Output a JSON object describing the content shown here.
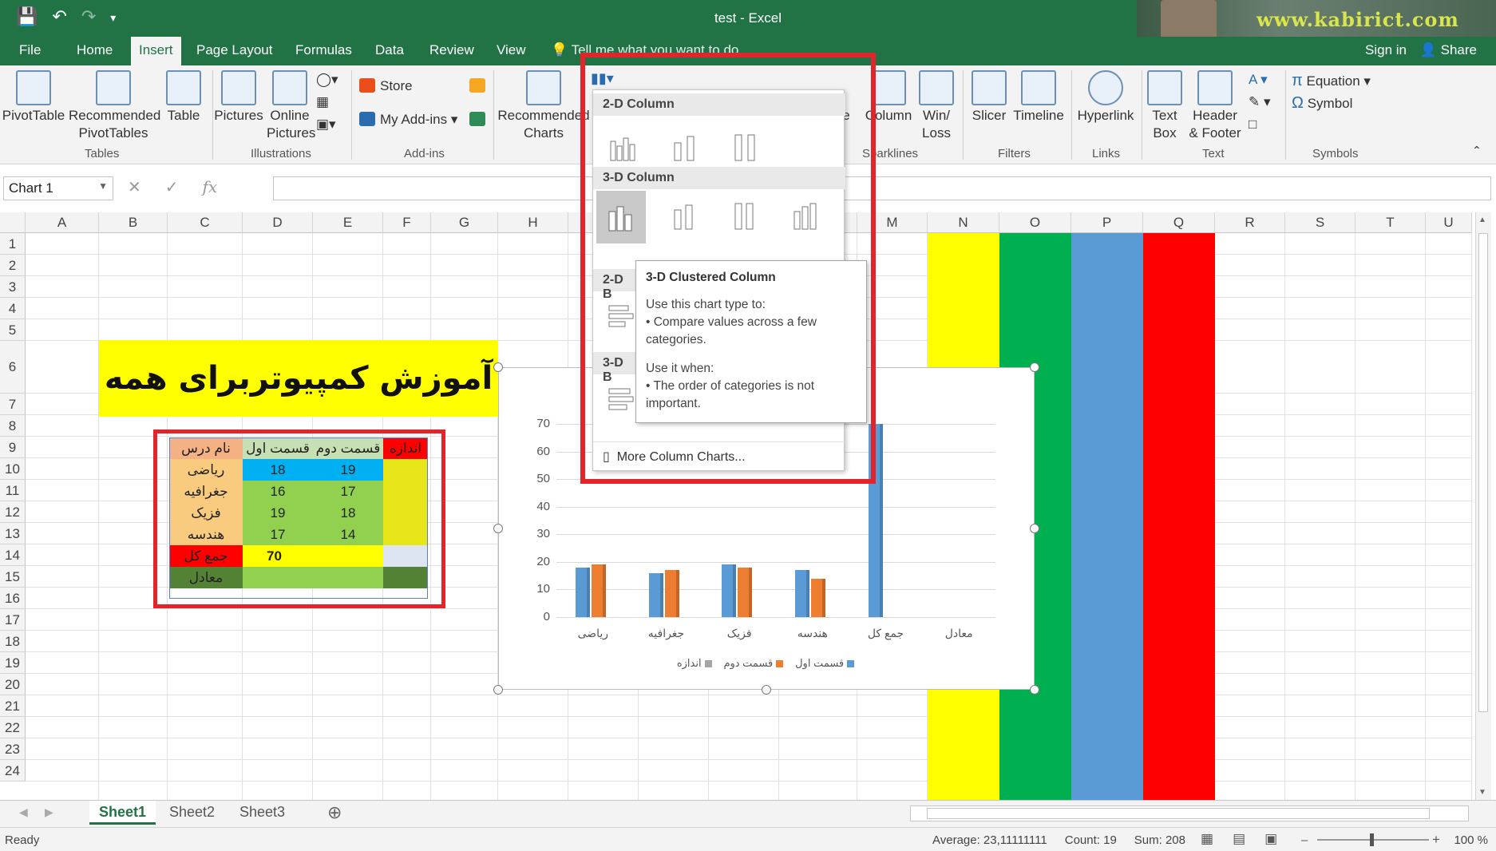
{
  "window": {
    "title": "test - Excel",
    "watermark": "www.kabirict.com"
  },
  "tabs": [
    "File",
    "Home",
    "Insert",
    "Page Layout",
    "Formulas",
    "Data",
    "Review",
    "View"
  ],
  "tell_me": "Tell me what you want to do",
  "account": {
    "sign_in": "Sign in",
    "share": "Share"
  },
  "ribbon": {
    "tables": {
      "label": "Tables",
      "pivot": "PivotTable",
      "rec_pivot": "Recommended PivotTables",
      "table": "Table"
    },
    "illustrations": {
      "label": "Illustrations",
      "pictures": "Pictures",
      "online_pictures": "Online Pictures"
    },
    "addins": {
      "label": "Add-ins",
      "store": "Store",
      "my_addins": "My Add-ins"
    },
    "charts": {
      "recommended": "Recommended Charts"
    },
    "sparklines": {
      "label": "Sparklines",
      "line_partial": "e",
      "column": "Column",
      "winloss": "Win/ Loss"
    },
    "filters": {
      "label": "Filters",
      "slicer": "Slicer",
      "timeline": "Timeline"
    },
    "links": {
      "label": "Links",
      "hyperlink": "Hyperlink"
    },
    "text": {
      "label": "Text",
      "textbox": "Text Box",
      "header": "Header & Footer"
    },
    "symbols": {
      "label": "Symbols",
      "equation": "Equation",
      "symbol": "Symbol"
    }
  },
  "formula_bar": {
    "name_box": "Chart 1",
    "fx": "fx",
    "value": ""
  },
  "columns": [
    "A",
    "B",
    "C",
    "D",
    "E",
    "F",
    "G",
    "H",
    "I",
    "J",
    "K",
    "L",
    "M",
    "N",
    "O",
    "P",
    "Q",
    "R",
    "S",
    "T",
    "U"
  ],
  "rows": [
    "1",
    "2",
    "3",
    "4",
    "5",
    "6",
    "7",
    "8",
    "9",
    "10",
    "11",
    "12",
    "13",
    "14",
    "15",
    "16",
    "17",
    "18",
    "19",
    "20",
    "21",
    "22",
    "23",
    "24"
  ],
  "banner_text": "آموزش کمپیوتربرای همه",
  "table": {
    "headers": {
      "lesson": "نام درس",
      "part1": "قسمت اول",
      "part2": "قسمت دوم",
      "size": "اندازه"
    },
    "rows": [
      {
        "name": "ریاضی",
        "p1": "18",
        "p2": "19"
      },
      {
        "name": "جغرافیه",
        "p1": "16",
        "p2": "17"
      },
      {
        "name": "فزیک",
        "p1": "19",
        "p2": "18"
      },
      {
        "name": "هندسه",
        "p1": "17",
        "p2": "14"
      }
    ],
    "total_label": "جمع کل",
    "total_value": "70",
    "avg_label": "معادل"
  },
  "chart_data": {
    "type": "bar",
    "categories": [
      "ریاضی",
      "جغرافیه",
      "فزیک",
      "هندسه",
      "جمع کل",
      "معادل"
    ],
    "series": [
      {
        "name": "قسمت اول",
        "values": [
          18,
          16,
          19,
          17,
          70,
          0
        ],
        "color": "#5b9bd5"
      },
      {
        "name": "قسمت دوم",
        "values": [
          19,
          17,
          18,
          14,
          0,
          0
        ],
        "color": "#ed7d31"
      },
      {
        "name": "اندازه",
        "values": [
          0,
          0,
          0,
          0,
          0,
          0
        ],
        "color": "#a5a5a5"
      }
    ],
    "y_ticks": [
      "70",
      "60",
      "50",
      "40",
      "30",
      "20",
      "10",
      "0"
    ],
    "ylim": [
      0,
      70
    ],
    "legend_position": "bottom"
  },
  "dropdown": {
    "section_2d": "2-D Column",
    "section_3d": "3-D Column",
    "section_2db": "2-D B",
    "section_3db": "3-D B",
    "more": "More Column Charts..."
  },
  "tooltip": {
    "title": "3-D Clustered Column",
    "intro": "Use this chart type to:",
    "bullet1": "• Compare values across a few categories.",
    "when": "Use it when:",
    "bullet2": "• The order of categories is not important."
  },
  "sheets": [
    "Sheet1",
    "Sheet2",
    "Sheet3"
  ],
  "status": {
    "ready": "Ready",
    "average": "Average: 23,11111111",
    "count": "Count: 19",
    "sum": "Sum: 208",
    "zoom": "100 %"
  },
  "colors": {
    "excel_green": "#217346",
    "yellow": "#ffff00",
    "green": "#00b050",
    "blue": "#5b9bd5",
    "red": "#ff0000",
    "highlight_red": "#e3242b"
  }
}
